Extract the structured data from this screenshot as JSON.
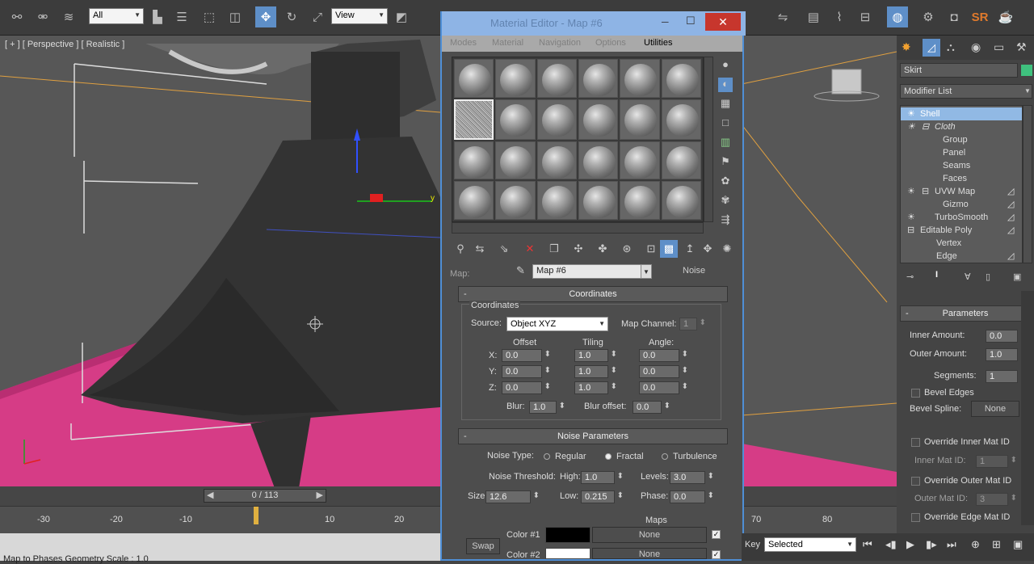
{
  "toolbar": {
    "filter_select": "All",
    "refcoord_select": "View",
    "render_label": "SR"
  },
  "viewport": {
    "label": "[ + ] [ Perspective ] [ Realistic ]",
    "axis_y": "y"
  },
  "timeline": {
    "slider": "0 / 113",
    "ticks": [
      "-30",
      "-20",
      "-10",
      "0",
      "10",
      "20"
    ],
    "right_ticks": [
      "70",
      "80"
    ]
  },
  "status": {
    "text": "Map to Phases Geometry Scale : 1.0"
  },
  "matedit": {
    "title": "Material Editor - Map #6",
    "menu": [
      "Modes",
      "Material",
      "Navigation",
      "Options",
      "Utilities"
    ],
    "map_label": "Map:",
    "map_name": "Map #6",
    "map_type": "Noise"
  },
  "coords": {
    "rollout": "Coordinates",
    "group": "Coordinates",
    "source_label": "Source:",
    "source_value": "Object XYZ",
    "mapchannel_label": "Map Channel:",
    "mapchannel_value": "1",
    "offset_label": "Offset",
    "tiling_label": "Tiling",
    "angle_label": "Angle:",
    "x_label": "X:",
    "y_label": "Y:",
    "z_label": "Z:",
    "offset": [
      "0.0",
      "0.0",
      "0.0"
    ],
    "tiling": [
      "1.0",
      "1.0",
      "1.0"
    ],
    "angle": [
      "0.0",
      "0.0",
      "0.0"
    ],
    "blur_label": "Blur:",
    "blur_value": "1.0",
    "bluroffset_label": "Blur offset:",
    "bluroffset_value": "0.0"
  },
  "noise": {
    "rollout": "Noise Parameters",
    "type_label": "Noise Type:",
    "types": [
      "Regular",
      "Fractal",
      "Turbulence"
    ],
    "selected_type": "Fractal",
    "threshold_label": "Noise Threshold:",
    "high_label": "High:",
    "high_value": "1.0",
    "levels_label": "Levels:",
    "levels_value": "3.0",
    "size_label": "Size:",
    "size_value": "12.6",
    "low_label": "Low:",
    "low_value": "0.215",
    "phase_label": "Phase:",
    "phase_value": "0.0",
    "maps_label": "Maps",
    "color1_label": "Color #1",
    "color2_label": "Color #2",
    "swap_label": "Swap",
    "none_label": "None",
    "color1": "#000000",
    "color2": "#ffffff"
  },
  "cmd": {
    "object_name": "Skirt",
    "object_color": "#3fc17e",
    "modifier_list": "Modifier List",
    "stack": [
      {
        "label": "Shell",
        "indent": 1,
        "selected": true
      },
      {
        "label": "Cloth",
        "indent": 1
      },
      {
        "label": "Group",
        "indent": 3
      },
      {
        "label": "Panel",
        "indent": 3
      },
      {
        "label": "Seams",
        "indent": 3
      },
      {
        "label": "Faces",
        "indent": 3
      },
      {
        "label": "UVW Map",
        "indent": 1
      },
      {
        "label": "Gizmo",
        "indent": 3
      },
      {
        "label": "TurboSmooth",
        "indent": 1
      },
      {
        "label": "Editable Poly",
        "indent": 0
      },
      {
        "label": "Vertex",
        "indent": 2
      },
      {
        "label": "Edge",
        "indent": 2
      }
    ],
    "params_title": "Parameters",
    "inner_label": "Inner Amount:",
    "inner_value": "0.0",
    "outer_label": "Outer Amount:",
    "outer_value": "1.0",
    "segments_label": "Segments:",
    "segments_value": "1",
    "bevel_edges": "Bevel Edges",
    "bevel_spline_label": "Bevel Spline:",
    "bevel_spline_value": "None",
    "override_inner": "Override Inner Mat ID",
    "inner_matid_label": "Inner Mat ID:",
    "inner_matid_value": "1",
    "override_outer": "Override Outer Mat ID",
    "outer_matid_label": "Outer Mat ID:",
    "outer_matid_value": "3",
    "override_edge": "Override Edge Mat ID"
  },
  "bottom": {
    "key_label": "Key",
    "selected_value": "Selected"
  }
}
